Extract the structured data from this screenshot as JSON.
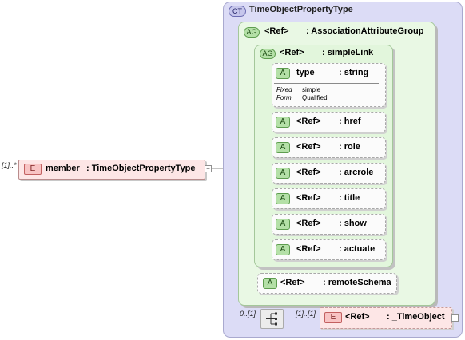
{
  "complex_type": {
    "badge": "CT",
    "name": "TimeObjectPropertyType"
  },
  "association_group": {
    "badge": "AG",
    "ref": "<Ref>",
    "name": ": AssociationAttributeGroup"
  },
  "simple_link": {
    "badge": "AG",
    "ref": "<Ref>",
    "name": ": simpleLink"
  },
  "type_attribute": {
    "badge": "A",
    "name": "type",
    "type": ": string",
    "fixed_label": "Fixed",
    "fixed_value": "simple",
    "form_label": "Form",
    "form_value": "Qualified"
  },
  "attributes": [
    {
      "badge": "A",
      "ref": "<Ref>",
      "name": ": href"
    },
    {
      "badge": "A",
      "ref": "<Ref>",
      "name": ": role"
    },
    {
      "badge": "A",
      "ref": "<Ref>",
      "name": ": arcrole"
    },
    {
      "badge": "A",
      "ref": "<Ref>",
      "name": ": title"
    },
    {
      "badge": "A",
      "ref": "<Ref>",
      "name": ": show"
    },
    {
      "badge": "A",
      "ref": "<Ref>",
      "name": ": actuate"
    }
  ],
  "remote_schema": {
    "badge": "A",
    "ref": "<Ref>",
    "name": ": remoteSchema"
  },
  "member": {
    "cardinality": "[1]..*",
    "badge": "E",
    "name": "member",
    "type": ": TimeObjectPropertyType",
    "expand": "−"
  },
  "sequence": {
    "cardinality_before": "0..[1]",
    "cardinality_after": "[1]..[1]",
    "icon": "sequence-icon"
  },
  "time_object": {
    "badge": "E",
    "ref": "<Ref>",
    "name": ": _TimeObject",
    "expand": "+"
  }
}
